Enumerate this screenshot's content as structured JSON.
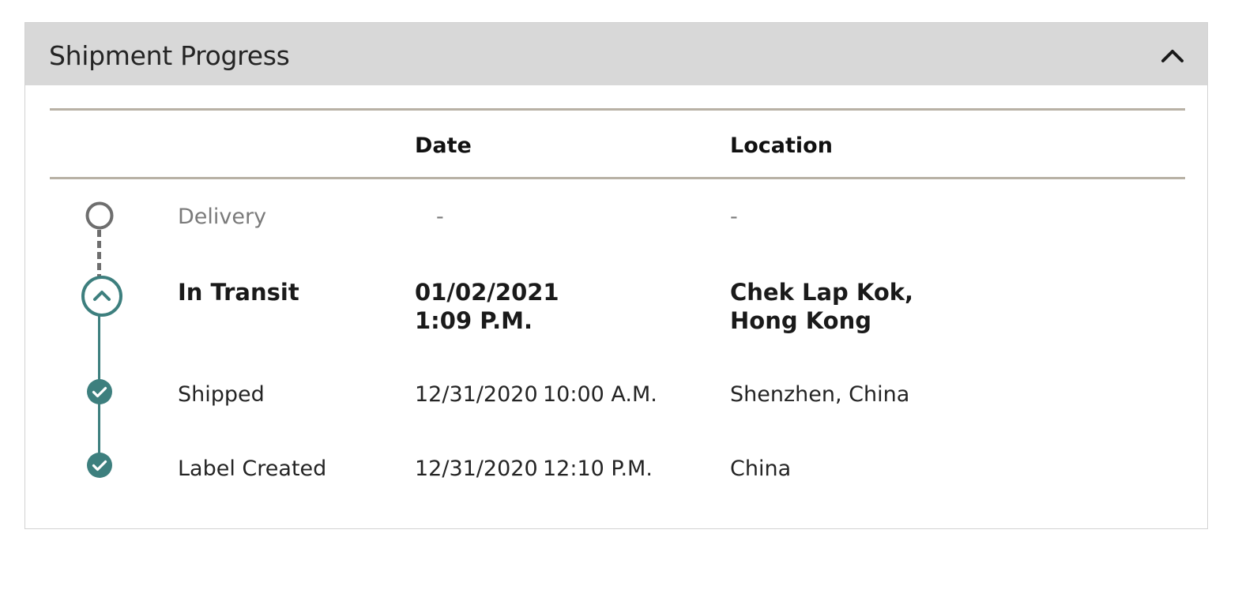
{
  "panel": {
    "title": "Shipment Progress",
    "collapse_icon": "chevron-up-icon"
  },
  "table": {
    "headers": {
      "status": "",
      "date": "Date",
      "location": "Location"
    },
    "rows": [
      {
        "status": "Delivery",
        "date": "-",
        "time": "",
        "location": "-",
        "icon": "empty-circle-icon"
      },
      {
        "status": "In Transit",
        "date": "01/02/2021",
        "time": "1:09 P.M.",
        "location_line1": "Chek Lap Kok,",
        "location_line2": "Hong Kong",
        "icon": "chevron-up-circle-icon"
      },
      {
        "status": "Shipped",
        "date": "12/31/2020",
        "time": "10:00 A.M.",
        "location": "Shenzhen, China",
        "icon": "check-circle-icon"
      },
      {
        "status": "Label Created",
        "date": "12/31/2020",
        "time": "12:10 P.M.",
        "location": "China",
        "icon": "check-circle-icon"
      }
    ]
  },
  "colors": {
    "accent": "#3d7f7e",
    "pending": "#6e6e6e",
    "header_bg": "#d8d8d8",
    "rule": "#b8b1a5"
  }
}
